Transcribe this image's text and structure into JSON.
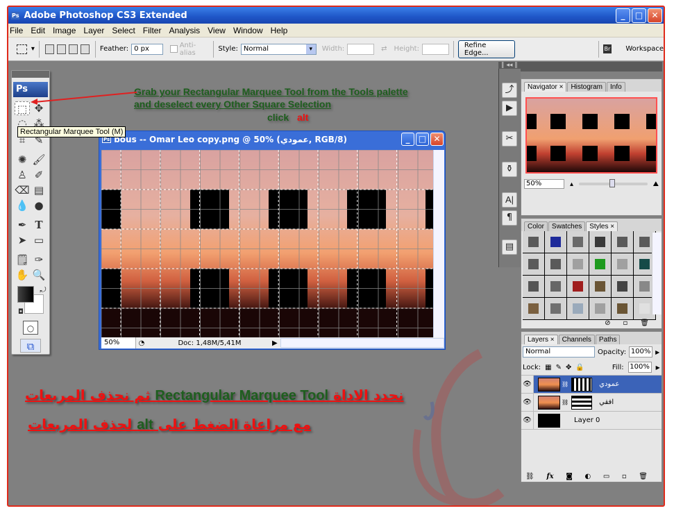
{
  "app": {
    "title": "Adobe Photoshop CS3 Extended",
    "icon": "ps-icon",
    "window_buttons": [
      "minimize",
      "maximize",
      "close"
    ]
  },
  "menu": [
    "File",
    "Edit",
    "Image",
    "Layer",
    "Select",
    "Filter",
    "Analysis",
    "View",
    "Window",
    "Help"
  ],
  "options_bar": {
    "tool_icon": "rectangular-marquee-icon",
    "feather_label": "Feather:",
    "feather_value": "0 px",
    "anti_alias_label": "Anti-alias",
    "anti_alias_checked": false,
    "style_label": "Style:",
    "style_value": "Normal",
    "width_label": "Width:",
    "height_label": "Height:",
    "refine_edge_label": "Refine Edge...",
    "bridge_icon": "bridge-icon",
    "workspace_label": "Workspace"
  },
  "tools_panel": {
    "logo": "Ps",
    "tooltip": "Rectangular Marquee Tool (M)",
    "tools": [
      "rectangular-marquee",
      "move",
      "lasso",
      "magic-wand",
      "crop",
      "slice",
      "healing-brush",
      "brush",
      "clone-stamp",
      "history-brush",
      "eraser",
      "gradient",
      "blur",
      "dodge",
      "pen",
      "type",
      "path-selection",
      "rectangle",
      "notes",
      "eyedropper",
      "hand",
      "zoom"
    ]
  },
  "instructions": {
    "line1": "Grab your Rectangular Marquee Tool from the Tools palette",
    "line2": "and deselect every Other Square Selection",
    "click": "click",
    "alt": "alt"
  },
  "document": {
    "title": "bous -- Omar Leo copy.png @ 50% (عمودي, RGB/8)",
    "zoom": "50%",
    "doc_info": "Doc: 1,48M/5,41M"
  },
  "navigator": {
    "tabs": [
      "Navigator",
      "Histogram",
      "Info"
    ],
    "active_tab": "Navigator",
    "zoom": "50%",
    "zoom_slider_fraction": 0.45
  },
  "styles_panel": {
    "tabs": [
      "Color",
      "Swatches",
      "Styles"
    ],
    "active_tab": "Styles",
    "swatches": [
      "#5a5a5a",
      "#1e2a9a",
      "#6a6a6a",
      "#3a3a3a",
      "#5a5a5a",
      "#5a5a5a",
      "#5a5a5a",
      "#5a5a5a",
      "#a0a0a0",
      "#1e9a1e",
      "#a0a0a0",
      "#154a48",
      "#555555",
      "#666666",
      "#a01e1e",
      "#6a5535",
      "#444444",
      "#888888",
      "#7a6040",
      "#707070",
      "#9aaabb",
      "#a0a0a0",
      "#6a5535",
      "#e0e0e0"
    ]
  },
  "layers_panel": {
    "tabs": [
      "Layers",
      "Channels",
      "Paths"
    ],
    "active_tab": "Layers",
    "blend_mode": "Normal",
    "opacity_label": "Opacity:",
    "opacity": "100%",
    "lock_label": "Lock:",
    "fill_label": "Fill:",
    "fill": "100%",
    "layers": [
      {
        "name": "عمودي",
        "selected": true,
        "mask": "vertical-stripes"
      },
      {
        "name": "افقي",
        "selected": false,
        "mask": "horizontal-stripes"
      },
      {
        "name": "Layer 0",
        "selected": false,
        "mask": null
      }
    ]
  },
  "arabic_caption": {
    "line1_part1": "نحدد الاداة",
    "line1_en": "Rectangular Marquee Tool",
    "line1_part2": "ثم نحذف المربعات",
    "line2_part1": "مع مراعاة الضغط على",
    "line2_en": "alt",
    "line2_part2": "لحذف المربعات"
  }
}
